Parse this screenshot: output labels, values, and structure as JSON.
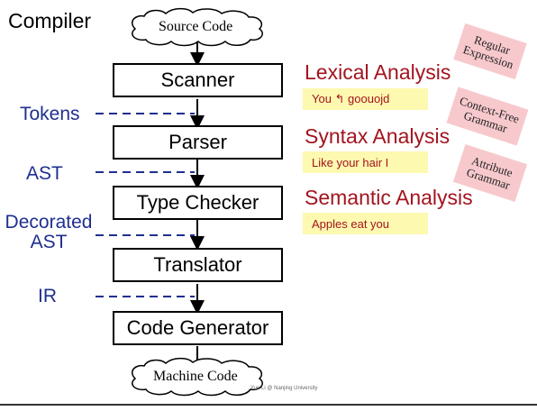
{
  "diagram": {
    "heading": "Compiler",
    "source_cloud": "Source Code",
    "machine_cloud": "Machine Code",
    "stages": [
      {
        "label": "Scanner"
      },
      {
        "label": "Parser"
      },
      {
        "label": "Type Checker"
      },
      {
        "label": "Translator"
      },
      {
        "label": "Code Generator"
      }
    ],
    "side_labels": [
      "Tokens",
      "AST",
      "Decorated AST",
      "IR"
    ],
    "analyses": [
      {
        "title": "Lexical Analysis",
        "example": "You ↰ goouojd",
        "tag": "Regular Expression"
      },
      {
        "title": "Syntax Analysis",
        "example": "Like your hair I",
        "tag": "Context-Free Grammar"
      },
      {
        "title": "Semantic Analysis",
        "example": "Apples eat you",
        "tag": "Attribute Grammar"
      }
    ],
    "credit": "Yue Li @ Nanjing University",
    "colors": {
      "analysis": "#a3141e",
      "side_label": "#1f2f8f",
      "example_bg": "#fdf9b0",
      "tag_bg": "#f7c9cd"
    }
  }
}
